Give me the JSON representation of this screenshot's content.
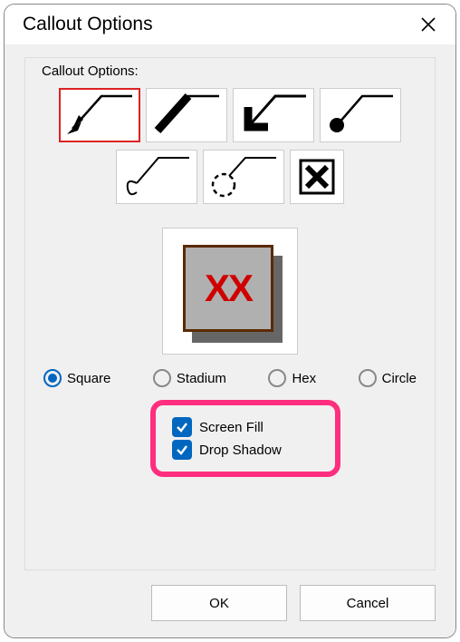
{
  "window": {
    "title": "Callout Options"
  },
  "group": {
    "label": "Callout Options:"
  },
  "styles": {
    "selected_index": 0,
    "items": [
      {
        "name": "arrow-pointer"
      },
      {
        "name": "thick-line"
      },
      {
        "name": "chevron-arrow"
      },
      {
        "name": "line-dot"
      },
      {
        "name": "curl-line"
      },
      {
        "name": "dash-circle"
      },
      {
        "name": "x-box"
      }
    ]
  },
  "preview": {
    "text": "XX"
  },
  "shape": {
    "options": [
      "Square",
      "Stadium",
      "Hex",
      "Circle"
    ],
    "selected": "Square"
  },
  "checks": {
    "screen_fill": {
      "label": "Screen Fill",
      "checked": true
    },
    "drop_shadow": {
      "label": "Drop Shadow",
      "checked": true
    }
  },
  "buttons": {
    "ok": "OK",
    "cancel": "Cancel"
  }
}
